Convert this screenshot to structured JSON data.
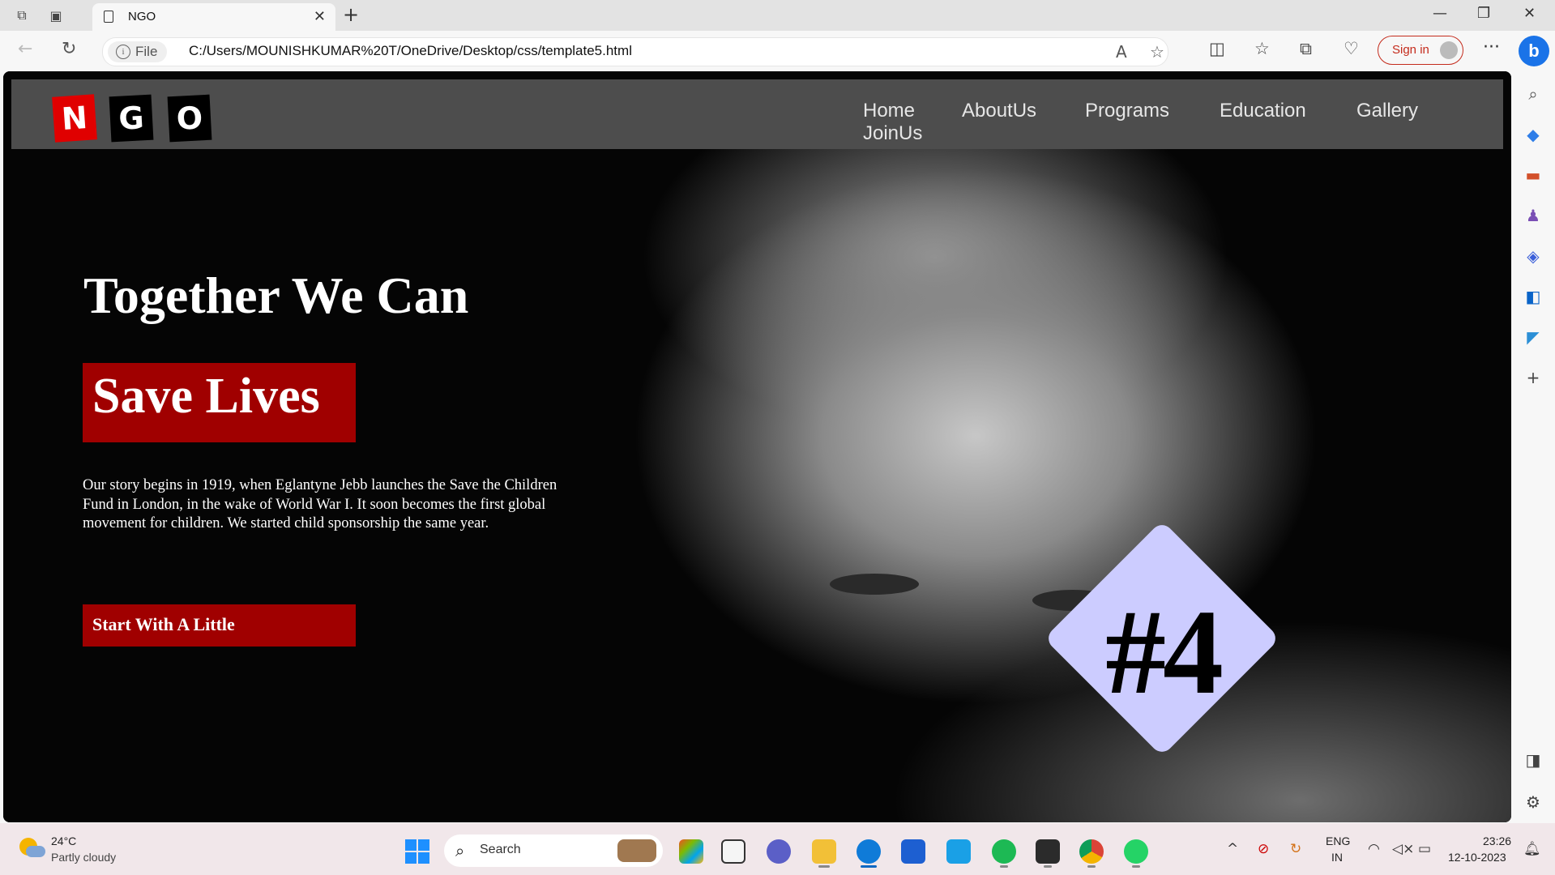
{
  "browser": {
    "tab_title": "NGO",
    "new_tab_symbol": "+",
    "close_symbol": "✕",
    "file_chip": "File",
    "url": "C:/Users/MOUNISHKUMAR%20T/OneDrive/Desktop/css/template5.html",
    "signin_label": "Sign in",
    "more_symbol": "···",
    "bing_letter": "b"
  },
  "site": {
    "logo_letters": [
      "N",
      "G",
      "O"
    ],
    "nav": [
      "Home",
      "AboutUs",
      "Programs",
      "Education",
      "Gallery",
      "JoinUs"
    ],
    "hero": {
      "title": "Together We Can",
      "badge": "Save Lives",
      "paragraph": "Our story begins in 1919, when Eglantyne Jebb launches the Save the Children Fund in London, in the wake of World War I. It soon becomes the first global movement for children. We started child sponsorship the same year.",
      "cta": "Start With A Little",
      "diamond_text": "#4"
    },
    "colors": {
      "accent_red": "#a00000",
      "diamond": "#ccccff",
      "nav_bg": "#4d4d4d"
    }
  },
  "taskbar": {
    "temperature": "24°C",
    "condition": "Partly cloudy",
    "search_placeholder": "Search",
    "lang_top": "ENG",
    "lang_bottom": "IN",
    "time": "23:26",
    "date": "12-10-2023"
  }
}
